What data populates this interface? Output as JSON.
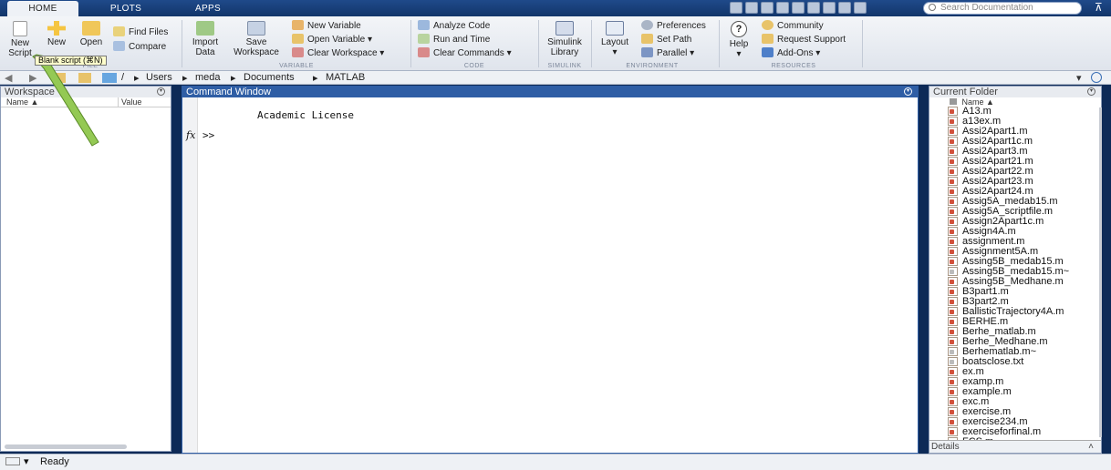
{
  "tabs": [
    "HOME",
    "PLOTS",
    "APPS"
  ],
  "search": {
    "placeholder": "Search Documentation"
  },
  "ribbon": {
    "file": {
      "new_script_line1": "New",
      "new_script_line2": "Script",
      "new": "New",
      "open": "Open",
      "find_files": "Find Files",
      "compare": "Compare",
      "group": "FILE"
    },
    "variable": {
      "import_line1": "Import",
      "import_line2": "Data",
      "save_line1": "Save",
      "save_line2": "Workspace",
      "new_variable": "New Variable",
      "open_variable": "Open Variable",
      "clear_workspace": "Clear Workspace",
      "group": "VARIABLE"
    },
    "code": {
      "analyze": "Analyze Code",
      "run_time": "Run and Time",
      "clear_commands": "Clear Commands",
      "group": "CODE"
    },
    "simulink": {
      "line1": "Simulink",
      "line2": "Library",
      "group": "SIMULINK"
    },
    "environment": {
      "layout": "Layout",
      "preferences": "Preferences",
      "set_path": "Set Path",
      "parallel": "Parallel",
      "group": "ENVIRONMENT"
    },
    "resources": {
      "help": "Help",
      "community": "Community",
      "request_support": "Request Support",
      "add_ons": "Add-Ons",
      "group": "RESOURCES"
    }
  },
  "tooltip": "Blank script (⌘N)",
  "path": [
    "/",
    "Users",
    "meda",
    "Documents",
    "MATLAB"
  ],
  "workspace": {
    "title": "Workspace",
    "col_name": "Name ▲",
    "col_value": "Value"
  },
  "command_window": {
    "title": "Command Window",
    "license": "Academic License",
    "fx": "fx",
    "prompt": ">>"
  },
  "current_folder": {
    "title": "Current Folder",
    "col_name": "Name ▲",
    "details": "Details",
    "files": [
      "A13.m",
      "a13ex.m",
      "Assi2Apart1.m",
      "Assi2Apart1c.m",
      "Assi2Apart3.m",
      "Assi2Apart21.m",
      "Assi2Apart22.m",
      "Assi2Apart23.m",
      "Assi2Apart24.m",
      "Assig5A_medab15.m",
      "Assig5A_scriptfile.m",
      "Assign2Apart1c.m",
      "Assign4A.m",
      "assignment.m",
      "Assignment5A.m",
      "Assing5B_medab15.m",
      "Assing5B_medab15.m~",
      "Assing5B_Medhane.m",
      "B3part1.m",
      "B3part2.m",
      "BallisticTrajectory4A.m",
      "BERHE.m",
      "Berhe_matlab.m",
      "Berhe_Medhane.m",
      "Berhematlab.m~",
      "boatsclose.txt",
      "ex.m",
      "examp.m",
      "example.m",
      "exc.m",
      "exercise.m",
      "exercise234.m",
      "exerciseforfinal.m",
      "FCS.m"
    ]
  },
  "status": {
    "text": "Ready"
  }
}
